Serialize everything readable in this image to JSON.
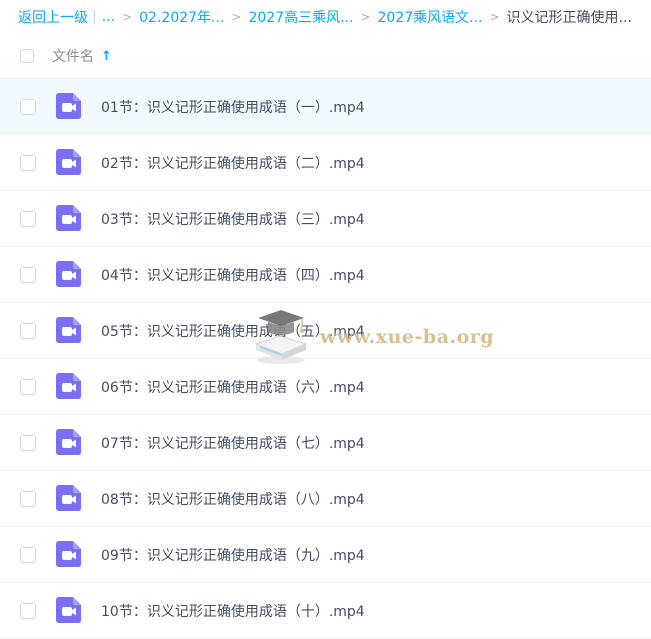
{
  "breadcrumb": {
    "back": "返回上一级",
    "separator": "|",
    "ellipsis": "...",
    "arrow": ">",
    "items": [
      "02.2027年...",
      "2027高三乘风...",
      "2027乘风语文..."
    ],
    "current": "识义记形正确使用..."
  },
  "header": {
    "column_name": "文件名",
    "sort_icon": "arrow-up-icon",
    "sort_glyph": "↑"
  },
  "files": [
    {
      "name": "01节：识义记形正确使用成语（一）.mp4",
      "icon": "video-file-icon",
      "highlighted": true
    },
    {
      "name": "02节：识义记形正确使用成语（二）.mp4",
      "icon": "video-file-icon",
      "highlighted": false
    },
    {
      "name": "03节：识义记形正确使用成语（三）.mp4",
      "icon": "video-file-icon",
      "highlighted": false
    },
    {
      "name": "04节：识义记形正确使用成语（四）.mp4",
      "icon": "video-file-icon",
      "highlighted": false
    },
    {
      "name": "05节：识义记形正确使用成语（五）.mp4",
      "icon": "video-file-icon",
      "highlighted": false
    },
    {
      "name": "06节：识义记形正确使用成语（六）.mp4",
      "icon": "video-file-icon",
      "highlighted": false
    },
    {
      "name": "07节：识义记形正确使用成语（七）.mp4",
      "icon": "video-file-icon",
      "highlighted": false
    },
    {
      "name": "08节：识义记形正确使用成语（八）.mp4",
      "icon": "video-file-icon",
      "highlighted": false
    },
    {
      "name": "09节：识义记形正确使用成语（九）.mp4",
      "icon": "video-file-icon",
      "highlighted": false
    },
    {
      "name": "10节：识义记形正确使用成语（十）.mp4",
      "icon": "video-file-icon",
      "highlighted": false
    }
  ],
  "watermark": {
    "text": "www.xue-ba.org"
  },
  "colors": {
    "link": "#09aaff",
    "text": "#424e67",
    "video_icon": "#7b6ef6",
    "row_highlight": "#f3faff"
  }
}
